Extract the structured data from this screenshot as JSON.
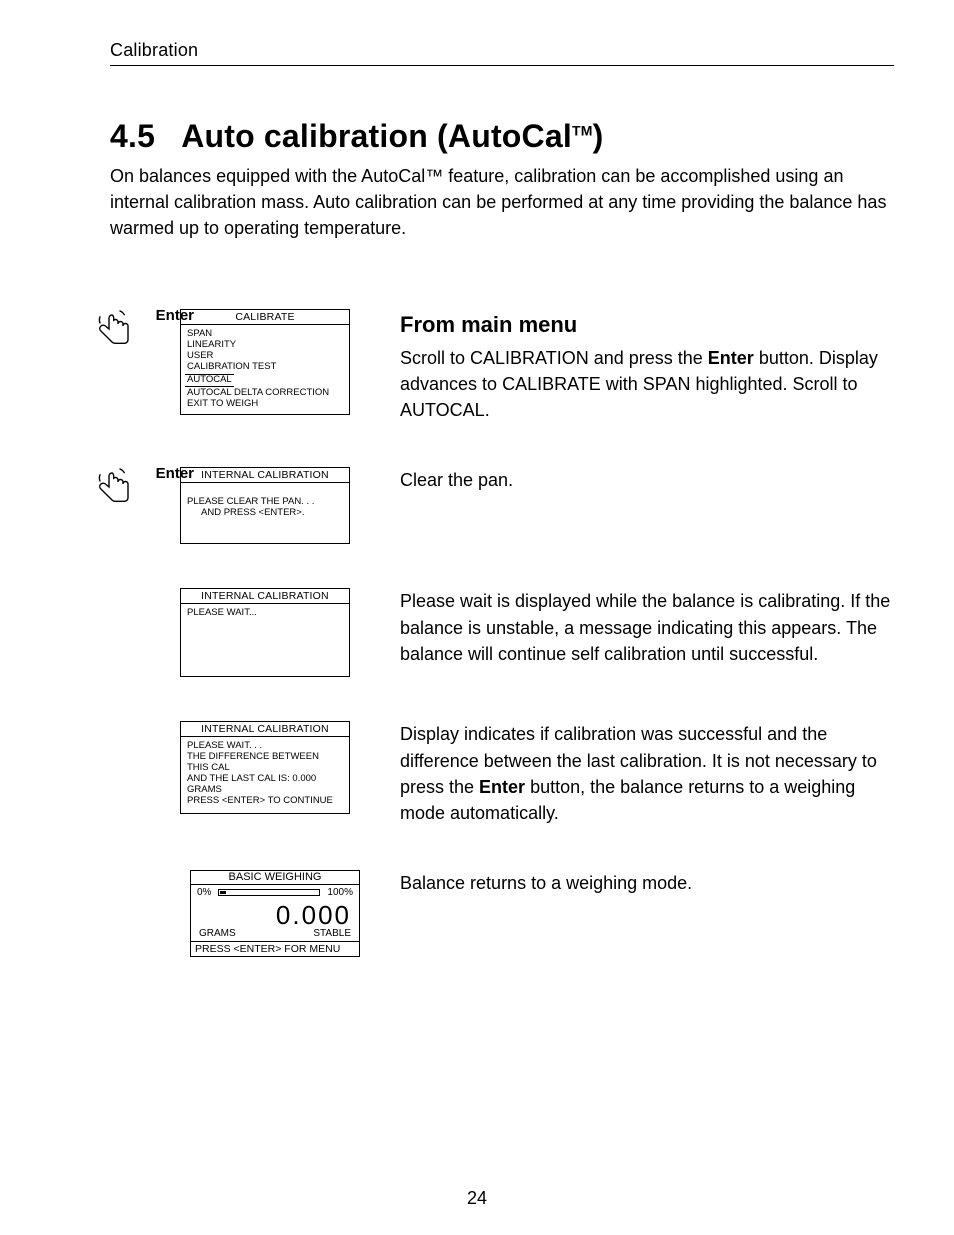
{
  "header": "Calibration",
  "section": {
    "number": "4.5",
    "heading": "Auto calibration (AutoCal",
    "tm": "TM",
    "close": ")"
  },
  "intro": "On balances equipped with the AutoCal™ feature, calibration can be accomplished using an internal calibration mass. Auto calibration can be performed at any time providing the balance has warmed up to operating temperature.",
  "enter_label": "Enter",
  "step1": {
    "screen_title": "CALIBRATE",
    "menu": [
      "SPAN",
      "LINEARITY",
      "USER",
      "CALIBRATION TEST"
    ],
    "menu_highlight": "AUTOCAL",
    "menu_after": [
      "AUTOCAL DELTA CORRECTION",
      "EXIT TO WEIGH"
    ],
    "heading": "From main menu",
    "text_a": "Scroll to CALIBRATION and press the ",
    "text_btn": "Enter",
    "text_b": " button.  Display advances to CALIBRATE with SPAN highlighted.  Scroll to AUTOCAL."
  },
  "step2": {
    "screen_title": "INTERNAL CALIBRATION",
    "line1": "PLEASE CLEAR THE PAN. . .",
    "line2": "AND PRESS <ENTER>.",
    "text": "Clear the pan."
  },
  "step3": {
    "screen_title": "INTERNAL CALIBRATION",
    "line1": "PLEASE WAIT...",
    "text": "Please wait is displayed while the balance is calibrating.  If the balance is unstable, a message indicating this appears.  The balance will continue self calibration until successful."
  },
  "step4": {
    "screen_title": "INTERNAL CALIBRATION",
    "lines": [
      "PLEASE WAIT. . .",
      "THE DIFFERENCE BETWEEN THIS CAL",
      "AND THE LAST CAL IS: 0.000 GRAMS",
      "PRESS <ENTER> TO CONTINUE"
    ],
    "text_a": "Display indicates if calibration was successful and the difference between the last calibration.  It is not necessary to press the ",
    "text_btn": "Enter",
    "text_b": " button, the balance returns to a weighing mode automatically."
  },
  "step5": {
    "title": "BASIC WEIGHING",
    "pct_lo": "0%",
    "pct_hi": "100%",
    "value": "0.000",
    "unit": "GRAMS",
    "status": "STABLE",
    "footer": "PRESS <ENTER> FOR MENU",
    "text": "Balance returns to a weighing mode."
  },
  "page_number": "24"
}
